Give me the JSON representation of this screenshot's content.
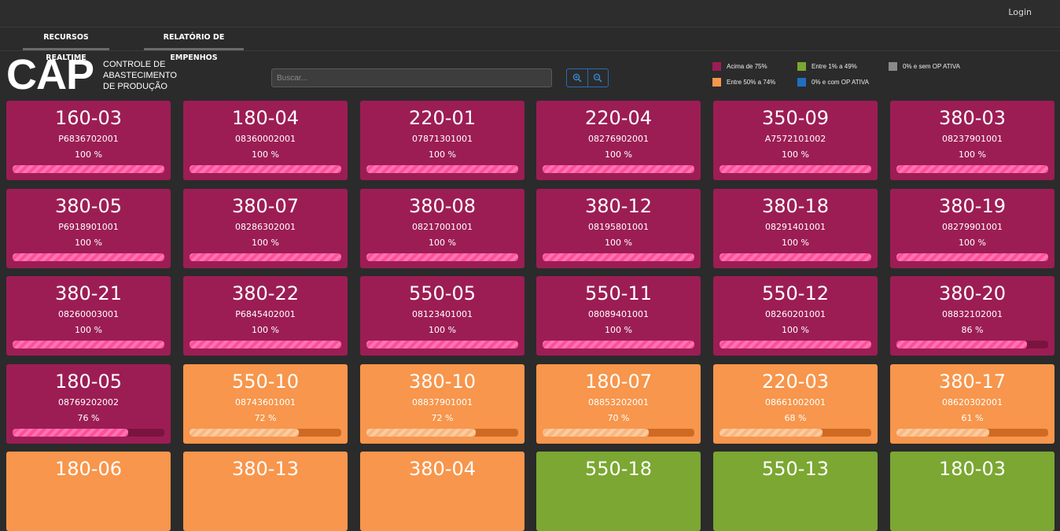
{
  "header": {
    "login": "Login"
  },
  "tabs": [
    {
      "label": "RECURSOS REALTIME"
    },
    {
      "label": "RELATÓRIO DE EMPENHOS"
    }
  ],
  "brand": {
    "logo": "CAP",
    "subtitle_lines": [
      "CONTROLE DE",
      "ABASTECIMENTO",
      "DE PRODUÇÃO"
    ]
  },
  "search": {
    "placeholder": "Buscar..."
  },
  "zoom": {
    "in_icon": "zoom-in-icon",
    "out_icon": "zoom-out-icon"
  },
  "legend": [
    {
      "label": "Acima de 75%",
      "color": "#9c1d54"
    },
    {
      "label": "Entre 1% a 49%",
      "color": "#7ba732"
    },
    {
      "label": "0% e sem OP ATIVA",
      "color": "#8a8a8a"
    },
    {
      "label": "Entre 50% a 74%",
      "color": "#f7964c"
    },
    {
      "label": "0% e com OP ATIVA",
      "color": "#1f6fc0"
    }
  ],
  "colors": {
    "high": {
      "bg": "#9c1d54",
      "track": "#7a143f",
      "fill_a": "#ff4f9a",
      "fill_b": "#ff74b4"
    },
    "mid": {
      "bg": "#f7964c",
      "track": "#cf6a23",
      "fill_a": "#f9b782",
      "fill_b": "#fccba0"
    },
    "low": {
      "bg": "#7ba732",
      "track": "#5c8220",
      "fill_a": "#9ccf52",
      "fill_b": "#b4de72"
    }
  },
  "cards": [
    {
      "title": "160-03",
      "code": "P6836702001",
      "percent": "100 %",
      "progress": 100,
      "level": "high"
    },
    {
      "title": "180-04",
      "code": "08360002001",
      "percent": "100 %",
      "progress": 100,
      "level": "high"
    },
    {
      "title": "220-01",
      "code": "07871301001",
      "percent": "100 %",
      "progress": 100,
      "level": "high"
    },
    {
      "title": "220-04",
      "code": "08276902001",
      "percent": "100 %",
      "progress": 100,
      "level": "high"
    },
    {
      "title": "350-09",
      "code": "A7572101002",
      "percent": "100 %",
      "progress": 100,
      "level": "high"
    },
    {
      "title": "380-03",
      "code": "08237901001",
      "percent": "100 %",
      "progress": 100,
      "level": "high"
    },
    {
      "title": "380-05",
      "code": "P6918901001",
      "percent": "100 %",
      "progress": 100,
      "level": "high"
    },
    {
      "title": "380-07",
      "code": "08286302001",
      "percent": "100 %",
      "progress": 100,
      "level": "high"
    },
    {
      "title": "380-08",
      "code": "08217001001",
      "percent": "100 %",
      "progress": 100,
      "level": "high"
    },
    {
      "title": "380-12",
      "code": "08195801001",
      "percent": "100 %",
      "progress": 100,
      "level": "high"
    },
    {
      "title": "380-18",
      "code": "08291401001",
      "percent": "100 %",
      "progress": 100,
      "level": "high"
    },
    {
      "title": "380-19",
      "code": "08279901001",
      "percent": "100 %",
      "progress": 100,
      "level": "high"
    },
    {
      "title": "380-21",
      "code": "08260003001",
      "percent": "100 %",
      "progress": 100,
      "level": "high"
    },
    {
      "title": "380-22",
      "code": "P6845402001",
      "percent": "100 %",
      "progress": 100,
      "level": "high"
    },
    {
      "title": "550-05",
      "code": "08123401001",
      "percent": "100 %",
      "progress": 100,
      "level": "high"
    },
    {
      "title": "550-11",
      "code": "08089401001",
      "percent": "100 %",
      "progress": 100,
      "level": "high"
    },
    {
      "title": "550-12",
      "code": "08260201001",
      "percent": "100 %",
      "progress": 100,
      "level": "high"
    },
    {
      "title": "380-20",
      "code": "08832102001",
      "percent": "86 %",
      "progress": 86,
      "level": "high"
    },
    {
      "title": "180-05",
      "code": "08769202002",
      "percent": "76 %",
      "progress": 76,
      "level": "high"
    },
    {
      "title": "550-10",
      "code": "08743601001",
      "percent": "72 %",
      "progress": 72,
      "level": "mid"
    },
    {
      "title": "380-10",
      "code": "08837901001",
      "percent": "72 %",
      "progress": 72,
      "level": "mid"
    },
    {
      "title": "180-07",
      "code": "08853202001",
      "percent": "70 %",
      "progress": 70,
      "level": "mid"
    },
    {
      "title": "220-03",
      "code": "08661002001",
      "percent": "68 %",
      "progress": 68,
      "level": "mid"
    },
    {
      "title": "380-17",
      "code": "08620302001",
      "percent": "61 %",
      "progress": 61,
      "level": "mid"
    },
    {
      "title": "180-06",
      "code": "",
      "percent": "",
      "progress": null,
      "level": "mid"
    },
    {
      "title": "380-13",
      "code": "",
      "percent": "",
      "progress": null,
      "level": "mid"
    },
    {
      "title": "380-04",
      "code": "",
      "percent": "",
      "progress": null,
      "level": "mid"
    },
    {
      "title": "550-18",
      "code": "",
      "percent": "",
      "progress": null,
      "level": "low"
    },
    {
      "title": "550-13",
      "code": "",
      "percent": "",
      "progress": null,
      "level": "low"
    },
    {
      "title": "180-03",
      "code": "",
      "percent": "",
      "progress": null,
      "level": "low"
    }
  ]
}
